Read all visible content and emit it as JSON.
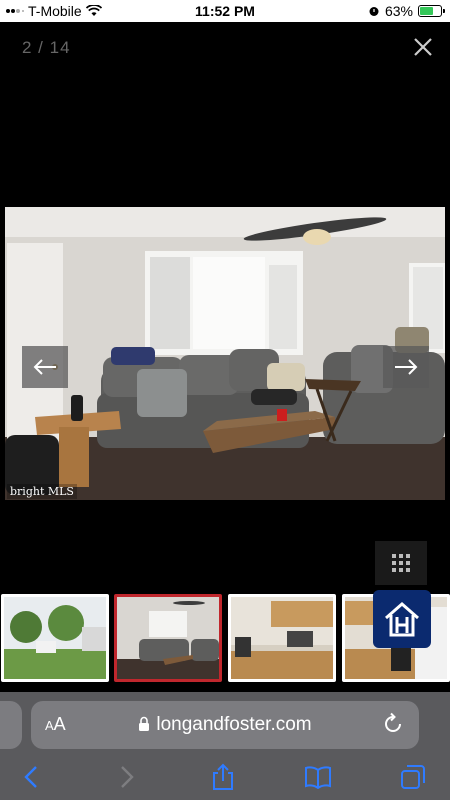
{
  "status_bar": {
    "carrier": "T-Mobile",
    "time": "11:52 PM",
    "battery_percent": "63%",
    "battery_level": 0.63,
    "icons": [
      "wifi-icon",
      "alarm-icon",
      "battery-charging-icon"
    ]
  },
  "gallery": {
    "counter": "2 / 14",
    "current_index": 2,
    "total": 14,
    "mls_logo": "bright MLS",
    "icons": [
      "close-icon",
      "arrow-left-icon",
      "arrow-right-icon",
      "grid-icon",
      "home-icon"
    ]
  },
  "thumbnails": [
    {
      "subject": "house-exterior",
      "selected": false
    },
    {
      "subject": "living-room",
      "selected": true
    },
    {
      "subject": "kitchen",
      "selected": false
    },
    {
      "subject": "kitchen-2",
      "selected": false
    }
  ],
  "colors": {
    "selected_border": "#c0272d",
    "brand_navy": "#0b2a6f",
    "battery_green": "#34c759"
  },
  "browser": {
    "aa_label_small": "A",
    "aa_label_large": "A",
    "url": "longandfoster.com",
    "icons": [
      "lock-icon",
      "reload-icon",
      "back-icon",
      "forward-icon",
      "share-icon",
      "bookmarks-icon",
      "tabs-icon"
    ]
  }
}
